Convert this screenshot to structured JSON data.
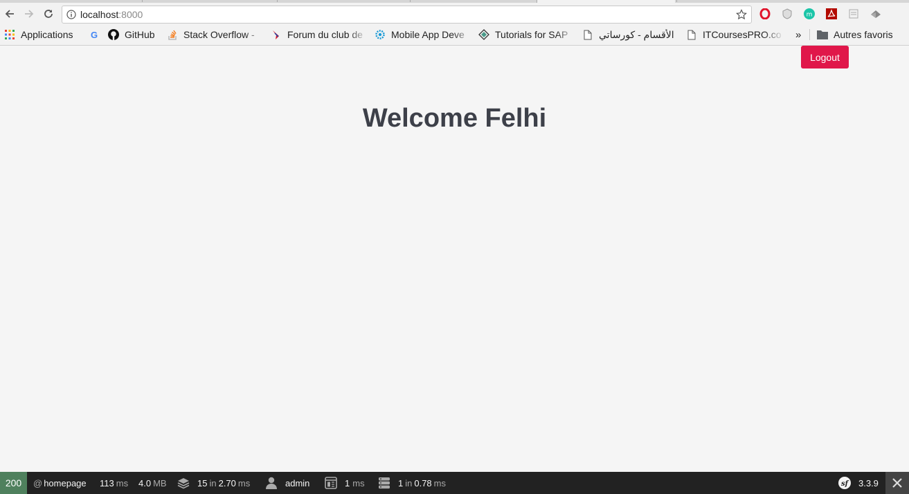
{
  "browser": {
    "url_host": "localhost",
    "url_port": ":8000",
    "bookmarks": [
      {
        "label": "Applications",
        "icon": "apps-grid-icon"
      },
      {
        "label": "",
        "icon": "google-icon"
      },
      {
        "label": "GitHub",
        "icon": "github-icon"
      },
      {
        "label": "Stack Overflow -",
        "icon": "stackoverflow-icon"
      },
      {
        "label": "Forum du club de",
        "icon": "forum-icon"
      },
      {
        "label": "Mobile App Deve",
        "icon": "gear-icon"
      },
      {
        "label": "Tutorials for SAP",
        "icon": "diamond-icon"
      },
      {
        "label": "الأقسام - كورساتي",
        "icon": "page-icon"
      },
      {
        "label": "ITCoursesPRO.co",
        "icon": "page-icon"
      }
    ],
    "more": "»",
    "other_bookmarks": "Autres favoris"
  },
  "page": {
    "logout_label": "Logout",
    "welcome": "Welcome Felhi"
  },
  "sf_toolbar": {
    "status": "200",
    "route_prefix": "@",
    "route": "homepage",
    "time_value": "113",
    "time_unit": "ms",
    "memory_value": "4.0",
    "memory_unit": "MB",
    "forms_count": "15",
    "forms_in": "in",
    "forms_time": "2.70",
    "forms_unit": "ms",
    "user": "admin",
    "twig_value": "1",
    "twig_unit": "ms",
    "db_count": "1",
    "db_in": "in",
    "db_time": "0.78",
    "db_unit": "ms",
    "version": "3.3.9"
  },
  "colors": {
    "logout_bg": "#e0174a",
    "status_bg": "#4f805d",
    "toolbar_bg": "#222222"
  }
}
